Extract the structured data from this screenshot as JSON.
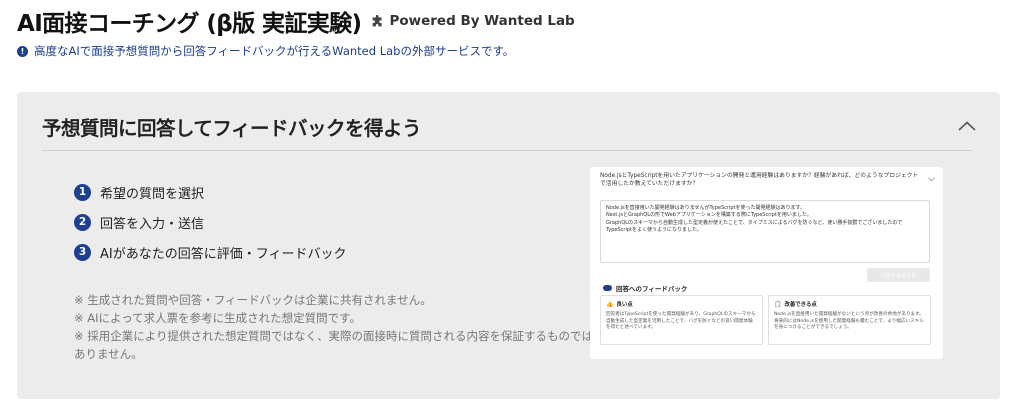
{
  "header": {
    "title": "AI面接コーチング (β版 実証実験)",
    "powered_by": "Powered By Wanted Lab",
    "notice": "高度なAIで面接予想質問から回答フィードバックが行えるWanted Labの外部サービスです。"
  },
  "card": {
    "title": "予想質問に回答してフィードバックを得よう",
    "steps": [
      {
        "num": "1",
        "label": "希望の質問を選択"
      },
      {
        "num": "2",
        "label": "回答を入力・送信"
      },
      {
        "num": "3",
        "label": "AIがあなたの回答に評価・フィードバック"
      }
    ],
    "notes": [
      "※ 生成された質問や回答・フィードバックは企業に共有されません。",
      "※ AIによって求人票を参考に生成された想定質問です。",
      "※ 採用企業により提供された想定質問ではなく、実際の面接時に質問される内容を保証するものではありません。"
    ]
  },
  "preview": {
    "question": "Node.jsとTypeScriptを用いたアプリケーションの開発と運用経験はありますか？経験があれば、どのようなプロジェクトで活用したか教えていただけますか？",
    "answer_lines": [
      "Node.jsを直接用いた開発経験はありませんがTypeScriptを使った開発経験はあります。",
      "Nest.jsとGraphQLの形でWebアプリケーションを構築する際にTypeScriptを用いました。",
      "GraphQLのスキーマから自動生成した型定義が使えたことで、タイプミスによるバグを防ぐなど、使い勝手抜群でございましたので",
      "TypeScriptをよく使うようになりました。"
    ],
    "submit_label": "回答を送信する",
    "feedback_title": "回答へのフィードバック",
    "good": {
      "title": "良い点",
      "body": "回答者はTypeScriptを使った開発経験があり、GraphQLのスキーマから自動生成した型定義を活用したことで、バグを防ぐなどの良い開発体験を得たと述べています。"
    },
    "improve": {
      "title": "改善できる点",
      "body": "Node.jsを直接用いた開発経験がないという点が改善の余地があります。将来的にはNode.jsを使用した開発経験も積むことで、より幅広いスキルを身につけることができるでしょう。"
    }
  },
  "colors": {
    "accent": "#1d3f91",
    "card_bg": "#ececec",
    "notice_text": "#1a3d8f"
  }
}
